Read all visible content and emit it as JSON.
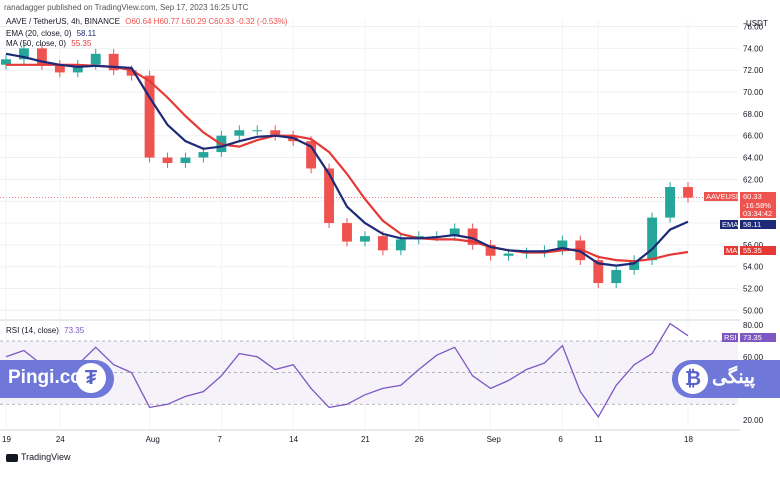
{
  "header": "ranadagger published on TradingView.com, Sep 17, 2023 16:25 UTC",
  "legend": {
    "symbol": "AAVE / TetherUS, 4h, BINANCE",
    "ohlc": "O60.64 H60.77 L60.29 C60.33 -0.32 (-0.53%)",
    "ema_label": "EMA (20, close, 0)",
    "ema_value": "58.11",
    "ma_label": "MA (50, close, 0)",
    "ma_value": "55.35",
    "rsi_label": "RSI (14, close)",
    "rsi_value": "73.35"
  },
  "price_axis": {
    "currency": "USDT",
    "ticks": [
      "76.00",
      "74.00",
      "72.00",
      "70.00",
      "68.00",
      "66.00",
      "64.00",
      "62.00",
      "60.00",
      "58.00",
      "56.00",
      "54.00",
      "52.00",
      "50.00"
    ]
  },
  "tags": {
    "price_name": "AAVEUSDT",
    "price_value": "60.33",
    "price_change": "-16.58%",
    "price_timer": "03:34:42",
    "ema_name": "EMA",
    "ema_value": "58.11",
    "ma_name": "MA",
    "ma_value": "55.35",
    "rsi_name": "RSI",
    "rsi_value": "73.35"
  },
  "rsi_axis": {
    "ticks": [
      "80.00",
      "60.00",
      "40.00",
      "20.00"
    ]
  },
  "time_axis": {
    "ticks": [
      "19",
      "24",
      "Aug",
      "7",
      "14",
      "21",
      "26",
      "Sep",
      "6",
      "11",
      "18"
    ]
  },
  "brand": {
    "left": "Pingi.co",
    "left_icon": "₮",
    "right_icon": "₿",
    "right": "پینگی"
  },
  "footer": "TradingView",
  "colors": {
    "up": "#26a69a",
    "down": "#ef5350",
    "ema": "#1e2a78",
    "ma": "#e53935",
    "rsi": "#7e57c2",
    "brand": "#6f78d8"
  },
  "chart_data": {
    "type": "candlestick",
    "interval": "4h",
    "ylim": [
      49.3,
      76.6
    ],
    "x": [
      "Jul 19",
      "Jul 20",
      "Jul 22",
      "Jul 24",
      "Jul 26",
      "Jul 28",
      "Jul 30",
      "Aug 1",
      "Aug 2",
      "Aug 3",
      "Aug 4",
      "Aug 5",
      "Aug 7",
      "Aug 9",
      "Aug 10",
      "Aug 12",
      "Aug 14",
      "Aug 16",
      "Aug 17",
      "Aug 18",
      "Aug 20",
      "Aug 21",
      "Aug 23",
      "Aug 25",
      "Aug 27",
      "Aug 29",
      "Aug 30",
      "Sep 1",
      "Sep 3",
      "Sep 5",
      "Sep 6",
      "Sep 8",
      "Sep 10",
      "Sep 11",
      "Sep 12",
      "Sep 14",
      "Sep 15",
      "Sep 16",
      "Sep 17"
    ],
    "close": [
      73.0,
      74.0,
      72.5,
      71.8,
      72.5,
      73.5,
      72.0,
      71.5,
      64.0,
      63.5,
      64.0,
      64.5,
      66.0,
      66.5,
      66.5,
      66.0,
      65.5,
      63.0,
      58.0,
      56.3,
      56.8,
      55.5,
      56.5,
      56.8,
      56.8,
      57.5,
      56.0,
      55.0,
      55.2,
      55.3,
      55.5,
      56.4,
      54.6,
      52.5,
      53.7,
      54.6,
      58.5,
      61.3,
      60.33
    ],
    "series": [
      {
        "name": "EMA (20, close, 0)",
        "values": [
          73.5,
          73.2,
          72.8,
          72.5,
          72.3,
          72.4,
          72.3,
          72.2,
          69.5,
          67.0,
          65.5,
          64.8,
          65.0,
          65.5,
          65.9,
          66.0,
          65.8,
          65.0,
          62.5,
          59.5,
          58.0,
          57.0,
          56.6,
          56.6,
          56.7,
          56.9,
          56.6,
          55.8,
          55.5,
          55.4,
          55.4,
          55.7,
          55.4,
          54.3,
          54.1,
          54.3,
          55.6,
          57.4,
          58.11
        ]
      },
      {
        "name": "MA (50, close, 0)",
        "values": [
          72.5,
          72.5,
          72.5,
          72.5,
          72.5,
          72.4,
          72.3,
          72.0,
          71.0,
          69.5,
          67.8,
          66.3,
          65.2,
          65.0,
          65.6,
          66.0,
          66.0,
          65.7,
          64.5,
          62.5,
          60.2,
          58.2,
          57.0,
          56.6,
          56.5,
          56.5,
          56.3,
          55.8,
          55.5,
          55.3,
          55.3,
          55.5,
          55.6,
          54.9,
          54.6,
          54.5,
          54.7,
          55.1,
          55.35
        ]
      },
      {
        "name": "RSI (14, close)",
        "values": [
          60,
          64,
          55,
          45,
          55,
          66,
          55,
          50,
          28,
          30,
          35,
          38,
          48,
          62,
          60,
          52,
          55,
          40,
          28,
          30,
          36,
          40,
          42,
          52,
          61,
          66,
          48,
          40,
          45,
          52,
          56,
          67,
          38,
          22,
          42,
          55,
          62,
          81,
          73.35
        ]
      }
    ],
    "rsi_ylim": [
      15,
      82
    ],
    "rsi_bands": [
      30,
      70
    ]
  }
}
